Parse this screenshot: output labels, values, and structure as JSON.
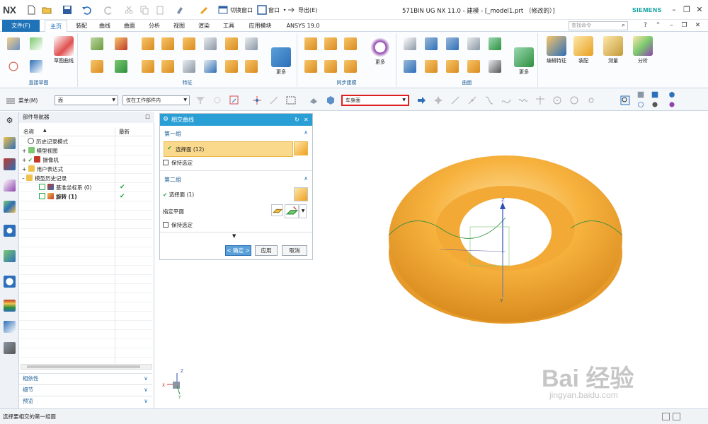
{
  "app": {
    "logo": "NX",
    "window_title": "571BIN UG NX 11.0 - 建模 - [_model1.prt （修改的）]",
    "brand": "SIEMENS",
    "switch_window": "切换窗口",
    "window_menu": "窗口",
    "export_menu": "导出(E)"
  },
  "menu": {
    "file": "文件(F)",
    "tabs": [
      "主页",
      "装配",
      "曲线",
      "曲面",
      "分析",
      "视图",
      "渲染",
      "工具",
      "应用模块",
      "ANSYS 19.0"
    ],
    "search_placeholder": "查找命令"
  },
  "ribbon": {
    "groups": [
      "直接草图",
      "特征",
      "同步建模",
      "曲面"
    ],
    "sketch_curve": "草图曲线",
    "more1": "更多",
    "more2": "更多",
    "more3": "更多",
    "edit_feature": "编辑特征",
    "assembly": "装配",
    "measure": "测量",
    "analysis": "分析"
  },
  "cmdbar": {
    "menu_label": "菜单(M)",
    "filter": "面",
    "scope": "仅在工作部件内",
    "face_rule": "车身面"
  },
  "navigator": {
    "title": "部件导航器",
    "col_name": "名称",
    "col_latest": "最新",
    "rows": [
      "历史记录模式",
      "模型视图",
      "摄像机",
      "用户表达式",
      "模型历史记录",
      "基准坐标系 (0)",
      "旋转 (1)"
    ],
    "accordion": [
      "相依性",
      "细节",
      "预览"
    ]
  },
  "dialog": {
    "title": "相交曲线",
    "group1": "第一组",
    "select_face1": "选择面 (12)",
    "keep1": "保持选定",
    "group2": "第二组",
    "select_face2": "选择面 (1)",
    "specify_plane": "指定平面",
    "keep2": "保持选定",
    "ok": "< 确定 >",
    "apply": "应用",
    "cancel": "取消"
  },
  "triad": {
    "x": "X",
    "y": "Y",
    "z": "Z"
  },
  "status": {
    "text": "选择要相交的第一组面"
  },
  "watermark": {
    "brand": "Bai 经验",
    "url": "jingyan.baidu.com"
  },
  "colors": {
    "accent": "#1e72b8",
    "dialog_title": "#2a9fd6",
    "highlight": "#fbd98c",
    "torus": "#f7b23e",
    "red_box": "#e02020"
  }
}
